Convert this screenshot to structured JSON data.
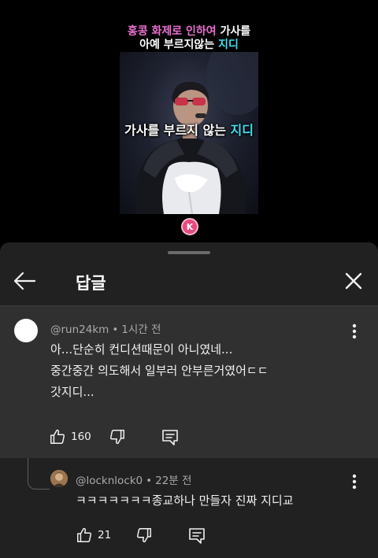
{
  "video": {
    "title_line1_pink": "홍콩 화제로 인하여",
    "title_line1_white": "가사를",
    "title_line2_white": "아예 부르지않는",
    "title_line2_cyan": "지디",
    "caption_main": "가사를 부르지 않는",
    "caption_highlight": "지디",
    "channel_logo_letter": "K"
  },
  "panel": {
    "title": "답글"
  },
  "comment": {
    "author": "@run24km",
    "time": "1시간 전",
    "text": "아...단순히 컨디션때문이 아니였네...\n중간중간 의도해서 일부러 안부른거였어ㄷㄷ\n갓지디...",
    "likes": "160"
  },
  "reply": {
    "author": "@locknlock0",
    "time": "22분 전",
    "text": "ㅋㅋㅋㅋㅋㅋㅋ종교하나 만들자 진짜 지디교",
    "likes": "21"
  },
  "colors": {
    "panel_bg": "#212121",
    "highlighted_comment_bg": "#303030",
    "accent_pink": "#e96fcf",
    "accent_cyan": "#3fe0ee"
  }
}
